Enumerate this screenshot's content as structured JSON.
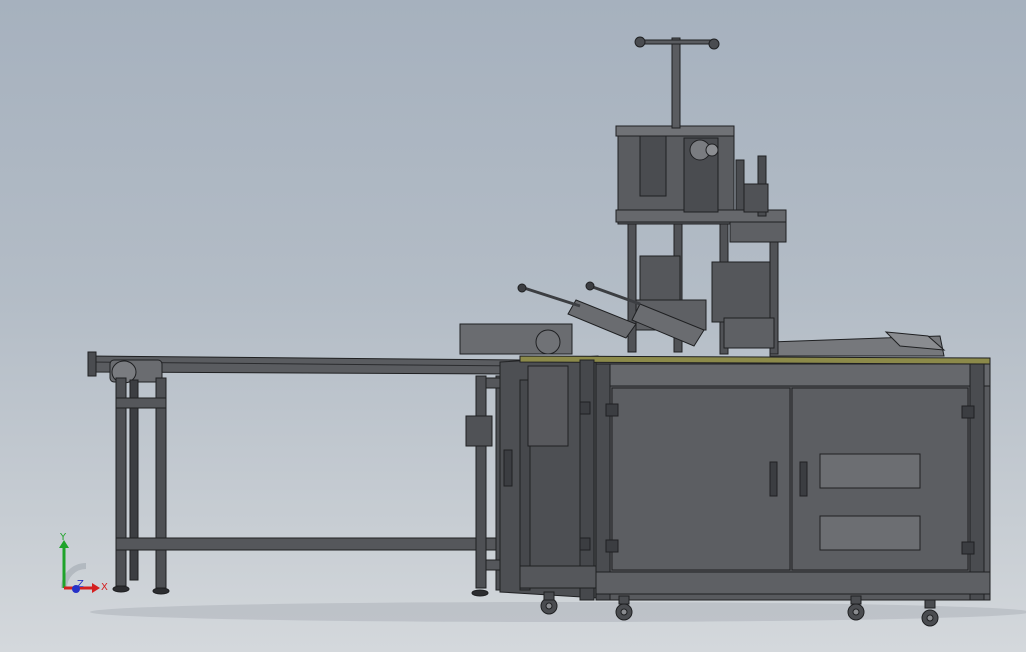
{
  "viewport": {
    "background_top": "#a6b1be",
    "background_bottom": "#d4d8dc"
  },
  "model": {
    "subject": "automatic-machine-assembly",
    "colors": {
      "body": "#56585c",
      "body_dark": "#3f4145",
      "edge": "#1f2022",
      "panel": "#616368",
      "table_top": "#8c8a4a"
    }
  },
  "triad": {
    "x_label": "X",
    "y_label": "Y",
    "z_label": "Z",
    "x_color": "#d42020",
    "y_color": "#1fa32a",
    "z_color": "#2530c8"
  }
}
